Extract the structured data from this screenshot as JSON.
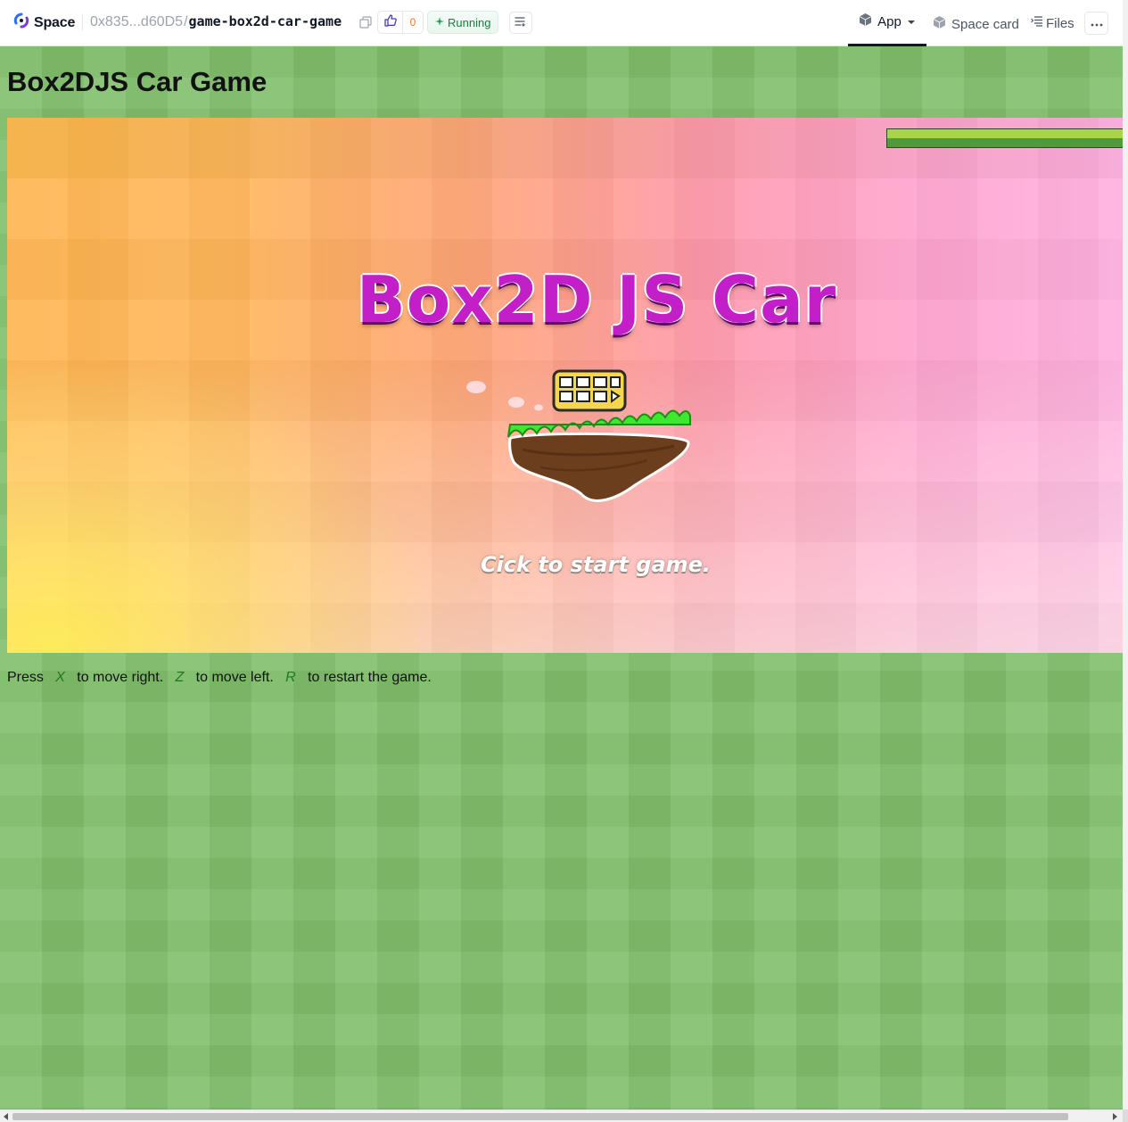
{
  "header": {
    "brand": "Space",
    "owner": "0x835...d60D5",
    "separator": "/",
    "repo": "game-box2d-car-game",
    "like_count": "0",
    "status": "Running",
    "tabs": {
      "app": "App",
      "space_card": "Space card",
      "files": "Files"
    },
    "colors": {
      "accent_orange": "#f97316",
      "status_green": "#15803d"
    }
  },
  "icons": {
    "brand": "spaces-logo-icon",
    "copy": "copy-icon",
    "like": "thumbs-up-icon",
    "status": "sparkle-icon",
    "logs": "logs-icon",
    "app": "cube-icon",
    "app_menu": "caret-down-icon",
    "space_card": "cube-icon",
    "files": "file-list-icon",
    "more": "ellipsis-icon"
  },
  "page": {
    "title": "Box2DJS Car Game"
  },
  "game": {
    "title": "Box2D JS Car",
    "start_prompt": "Cick to start game.",
    "loading_progress": 1.0
  },
  "instructions": {
    "press": "Press",
    "key_right": "X",
    "right_text": "to move right.",
    "key_left": "Z",
    "left_text": "to move left.",
    "key_restart": "R",
    "restart_text": "to restart the game."
  }
}
